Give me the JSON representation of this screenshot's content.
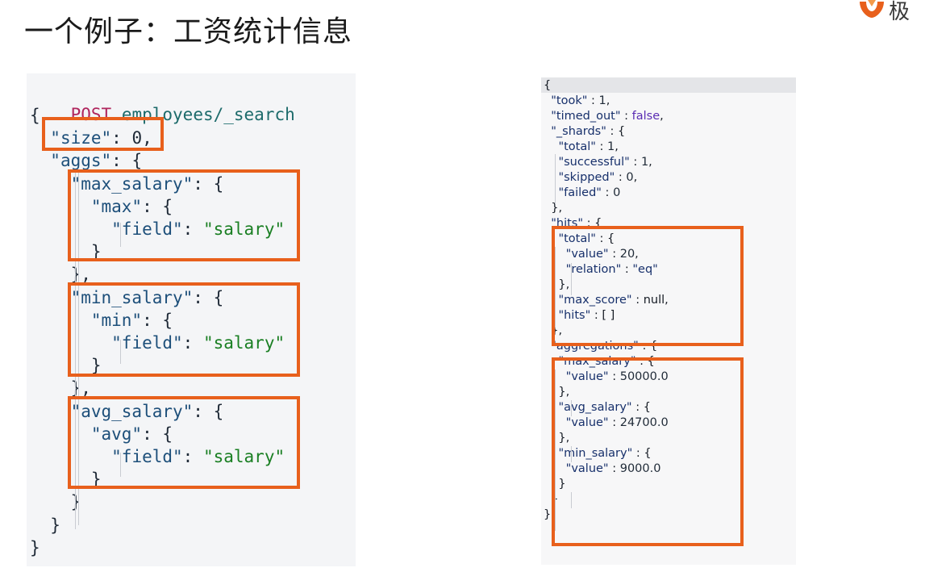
{
  "slide": {
    "title": "一个例子：工资统计信息",
    "logo_text": "极",
    "brand_color": "#e8601c"
  },
  "request": {
    "method": "POST",
    "endpoint": "employees/_search",
    "lines": [
      "{",
      "  \"size\": 0,",
      "  \"aggs\": {",
      "    \"max_salary\": {",
      "      \"max\": {",
      "        \"field\": \"salary\"",
      "      }",
      "    },",
      "    \"min_salary\": {",
      "      \"min\": {",
      "        \"field\": \"salary\"",
      "      }",
      "    },",
      "    \"avg_salary\": {",
      "      \"avg\": {",
      "        \"field\": \"salary\"",
      "      }",
      "    }",
      "  }",
      "}"
    ]
  },
  "response": {
    "lines": [
      "{",
      "  \"took\" : 1,",
      "  \"timed_out\" : false,",
      "  \"_shards\" : {",
      "    \"total\" : 1,",
      "    \"successful\" : 1,",
      "    \"skipped\" : 0,",
      "    \"failed\" : 0",
      "  },",
      "  \"hits\" : {",
      "    \"total\" : {",
      "      \"value\" : 20,",
      "      \"relation\" : \"eq\"",
      "    },",
      "    \"max_score\" : null,",
      "    \"hits\" : [ ]",
      "  },",
      "  \"aggregations\" : {",
      "    \"max_salary\" : {",
      "      \"value\" : 50000.0",
      "    },",
      "    \"avg_salary\" : {",
      "      \"value\" : 24700.0",
      "    },",
      "    \"min_salary\" : {",
      "      \"value\" : 9000.0",
      "    }",
      "  }",
      "}"
    ]
  }
}
